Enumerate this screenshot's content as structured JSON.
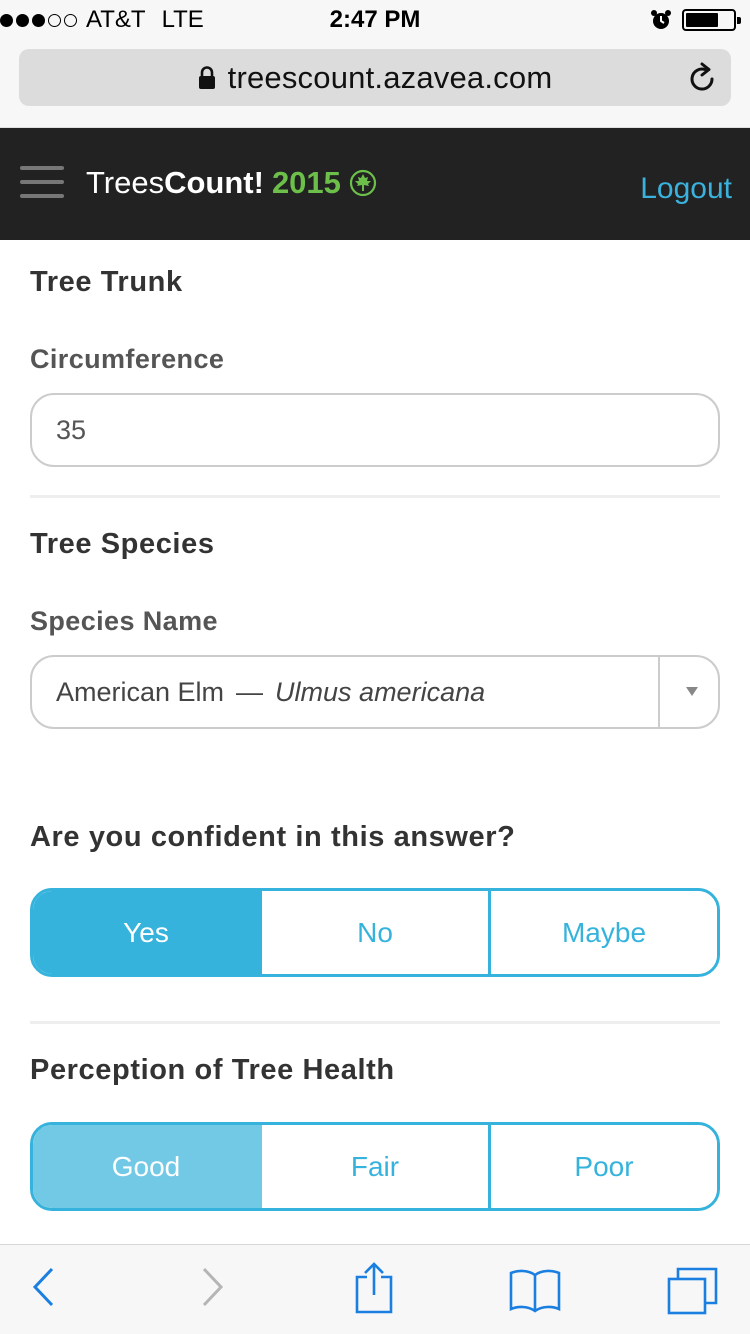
{
  "status_bar": {
    "carrier": "AT&T",
    "network": "LTE",
    "time": "2:47 PM",
    "signal_bars": 3,
    "signal_total": 5,
    "battery_level": 0.7,
    "icons": [
      "alarm-icon",
      "battery-icon"
    ]
  },
  "browser": {
    "url": "treescount.azavea.com",
    "icons": [
      "lock-icon",
      "reload-icon"
    ]
  },
  "header": {
    "brand_light": "Trees",
    "brand_bold": "Count!",
    "brand_year": "2015",
    "logout_label": "Logout",
    "colors": {
      "background": "#222222",
      "accent": "#3ab2dd",
      "brand_green": "#6cc04a"
    }
  },
  "form": {
    "trunk": {
      "title": "Tree Trunk",
      "circumference_label": "Circumference",
      "circumference_value": "35"
    },
    "species": {
      "title": "Tree Species",
      "name_label": "Species Name",
      "common_name": "American Elm",
      "separator": "—",
      "scientific_name": "Ulmus americana"
    },
    "confidence": {
      "question": "Are you confident in this answer?",
      "options": [
        "Yes",
        "No",
        "Maybe"
      ],
      "selected": "Yes"
    },
    "health": {
      "title": "Perception of Tree Health",
      "options": [
        "Good",
        "Fair",
        "Poor"
      ],
      "selected": "Good"
    }
  },
  "toolbar": {
    "icons": [
      "back-icon",
      "forward-icon",
      "share-icon",
      "bookmarks-icon",
      "tabs-icon"
    ]
  }
}
